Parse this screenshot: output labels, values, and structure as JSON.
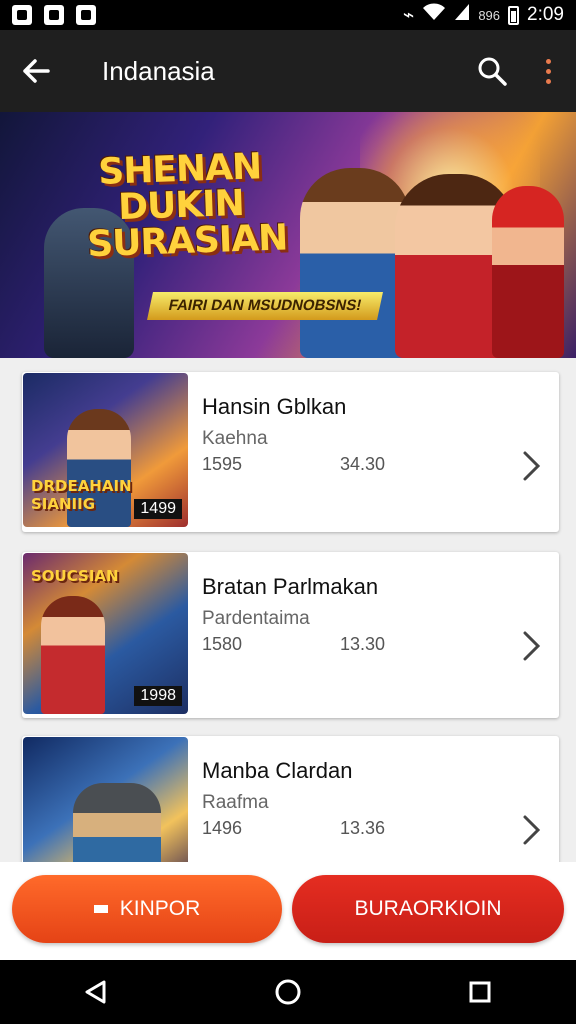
{
  "status_bar": {
    "left_icons": [
      "notification-icon",
      "notification-icon",
      "notification-icon"
    ],
    "small_text": "896",
    "time": "2:09"
  },
  "app_bar": {
    "title": "Indanasia"
  },
  "banner": {
    "title_lines": [
      "SHENAN",
      "DUKIN",
      "SURASIAN"
    ],
    "subtitle": "FAIRI DAN MSUDNOBSNS!"
  },
  "items": [
    {
      "name": "Hansin Gblkan",
      "subtitle": "Kaehna",
      "meta_left": "1595",
      "meta_right": "34.30",
      "thumb_text": "DRDEAHAIN SIANIIG",
      "thumb_badge": "1499"
    },
    {
      "name": "Bratan Parlmakan",
      "subtitle": "Pardentaima",
      "meta_left": "1580",
      "meta_right": "13.30",
      "thumb_text": "SOUCSIAN",
      "thumb_badge": "1998"
    },
    {
      "name": "Manba Clardan",
      "subtitle": "Raafma",
      "meta_left": "1496",
      "meta_right": "13.36",
      "thumb_text": "",
      "thumb_badge": ""
    }
  ],
  "actions": {
    "left_label": "KINPOR",
    "right_label": "BURAORKIOIN"
  },
  "colors": {
    "status_bar": "#000000",
    "app_bar": "#1f1f1f",
    "accent_orange": "#ff6a2a",
    "accent_red": "#e52d21",
    "background": "#efefef",
    "more_dots": "#e97b4e"
  },
  "icons": {
    "back": "back-arrow-icon",
    "search": "search-icon",
    "more": "more-vert-icon",
    "chevron": "chevron-right-icon",
    "nav_back": "nav-back-icon",
    "nav_home": "nav-home-icon",
    "nav_recents": "nav-recents-icon",
    "wifi": "wifi-icon",
    "signal": "signal-icon",
    "battery": "battery-icon"
  }
}
